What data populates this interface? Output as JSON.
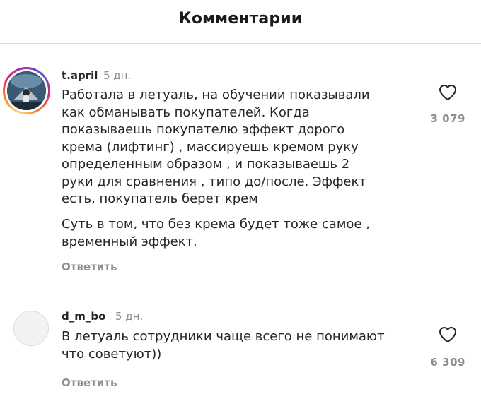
{
  "header": {
    "title": "Комментарии"
  },
  "comments": [
    {
      "username": "t.april",
      "time": "5 дн.",
      "text1": "Работала в летуаль, на обучении показывали\nкак обманывать покупателей. Когда\nпоказываешь покупателю  эффект дорого\nкрема (лифтинг) , массируешь кремом руку\nопределенным образом , и показываешь 2\nруки для сравнения , типо до/после. Эффект\nесть, покупатель берет крем",
      "text2": "Суть в том, что без крема будет тоже самое ,\nвременный эффект.",
      "reply": "Ответить",
      "likes": "3 079",
      "like_icon": "heart-outline-icon",
      "avatar": "story-ring-avatar"
    },
    {
      "username": "d_m_bo",
      "time": "5 дн.",
      "text1": "В летуаль сотрудники чаще всего не понимают\nчто советуют))",
      "reply": "Ответить",
      "likes": "6 309",
      "like_icon": "heart-outline-icon",
      "avatar": "empty-avatar"
    }
  ],
  "colors": {
    "text": "#262626",
    "muted": "#8e8e8e",
    "divider": "#dbdbdb"
  }
}
